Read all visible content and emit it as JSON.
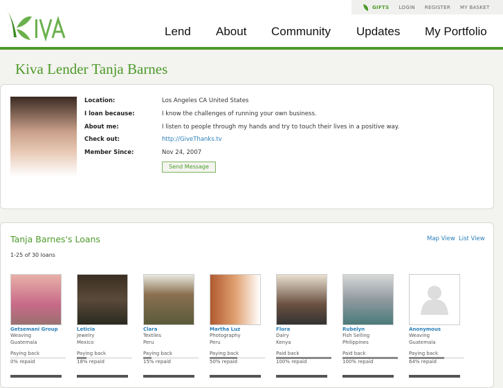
{
  "header": {
    "logo": "KIVA",
    "utility": [
      "GIFTS",
      "LOGIN",
      "REGISTER",
      "MY BASKET"
    ],
    "nav": [
      "Lend",
      "About",
      "Community",
      "Updates",
      "My Portfolio"
    ]
  },
  "page_title": "Kiva Lender Tanja Barnes",
  "profile": {
    "rows": [
      {
        "label": "Location:",
        "value": "Los Angeles CA United States"
      },
      {
        "label": "I loan because:",
        "value": "I know the challenges of running your own business."
      },
      {
        "label": "About me:",
        "value": "I listen to people through my hands and try to touch their lives in a positive way."
      },
      {
        "label": "Check out:",
        "value": "http://GiveThanks.tv"
      },
      {
        "label": "Member Since:",
        "value": "Nov 24, 2007"
      }
    ],
    "send_message": "Send Message"
  },
  "loans": {
    "heading": "Tanja Barnes's Loans",
    "map_view": "Map View",
    "list_view": "List View",
    "count": "1-25 of 30 loans",
    "items": [
      {
        "name": "Getsemani Group",
        "sector": "Weaving",
        "country": "Guatemala",
        "status": "Paying back",
        "repaid": "0% repaid",
        "pct": 0
      },
      {
        "name": "Leticia",
        "sector": "Jewelry",
        "country": "Mexico",
        "status": "Paying back",
        "repaid": "18% repaid",
        "pct": 18
      },
      {
        "name": "Clara",
        "sector": "Textiles",
        "country": "Peru",
        "status": "Paying back",
        "repaid": "15% repaid",
        "pct": 15
      },
      {
        "name": "Martha Luz",
        "sector": "Photography",
        "country": "Peru",
        "status": "Paying back",
        "repaid": "50% repaid",
        "pct": 50
      },
      {
        "name": "Flora",
        "sector": "Dairy",
        "country": "Kenya",
        "status": "Paid back",
        "repaid": "100% repaid",
        "pct": 100
      },
      {
        "name": "Rubelyn",
        "sector": "Fish Selling",
        "country": "Philippines",
        "status": "Paid back",
        "repaid": "100% repaid",
        "pct": 100
      },
      {
        "name": "Anonymous",
        "sector": "Weaving",
        "country": "Guatemala",
        "status": "Paying back",
        "repaid": "64% repaid",
        "pct": 64
      }
    ]
  },
  "colors": {
    "brand": "#4d9a2a",
    "link": "#2a7fb8"
  }
}
